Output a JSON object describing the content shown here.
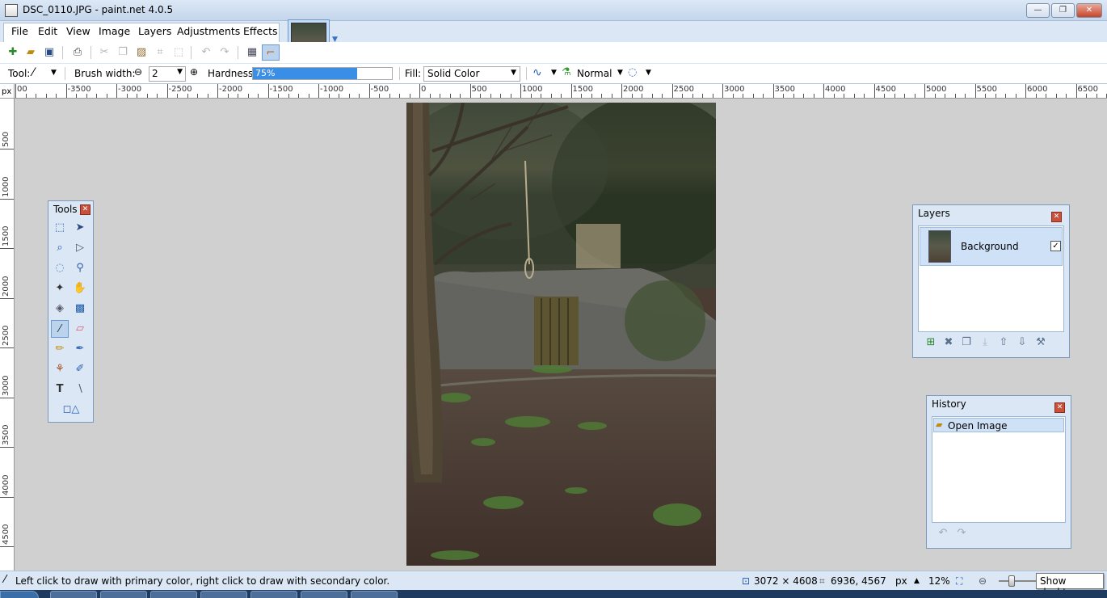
{
  "window": {
    "title": "DSC_0110.JPG - paint.net 4.0.5",
    "minimize_glyph": "—",
    "maximize_glyph": "❐",
    "close_glyph": "✕"
  },
  "menu": {
    "file": "File",
    "edit": "Edit",
    "view": "View",
    "image": "Image",
    "layers": "Layers",
    "adjustments": "Adjustments",
    "effects": "Effects"
  },
  "toolbar": {
    "tool_label": "Tool:",
    "brush_width_label": "Brush width:",
    "brush_width_value": "2",
    "hardness_label": "Hardness:",
    "hardness_value": "75%",
    "hardness_fraction": 0.75,
    "fill_label": "Fill:",
    "fill_value": "Solid Color",
    "blend_mode": "Normal"
  },
  "ruler": {
    "unit": "px",
    "h_labels": [
      "00",
      "-3500",
      "-3000",
      "-2500",
      "-2000",
      "-1500",
      "-1000",
      "-500",
      "0",
      "500",
      "1000",
      "1500",
      "2000",
      "2500",
      "3000",
      "3500",
      "4000",
      "4500",
      "5000",
      "5500",
      "6000",
      "6500"
    ],
    "v_labels": [
      "500",
      "1000",
      "1500",
      "2000",
      "2500",
      "3000",
      "3500",
      "4000",
      "4500"
    ]
  },
  "tools_window": {
    "title": "Tools",
    "close_glyph": "✕",
    "selected_tool": "paintbrush"
  },
  "layers_window": {
    "title": "Layers",
    "close_glyph": "✕",
    "layers": [
      {
        "name": "Background",
        "visible": true
      }
    ],
    "checkbox_glyph": "✓"
  },
  "history_window": {
    "title": "History",
    "close_glyph": "✕",
    "items": [
      {
        "label": "Open Image"
      }
    ]
  },
  "status": {
    "hint": "Left click to draw with primary color, right click to draw with secondary color.",
    "image_size": "3072 × 4608",
    "cursor_position": "6936, 4567",
    "unit": "px",
    "zoom": "12%",
    "show_desktop": "Show desktop"
  },
  "colors": {
    "accent": "#3a8ee6",
    "chrome": "#dbe7f5",
    "canvas_bg": "#d0d0d0"
  }
}
